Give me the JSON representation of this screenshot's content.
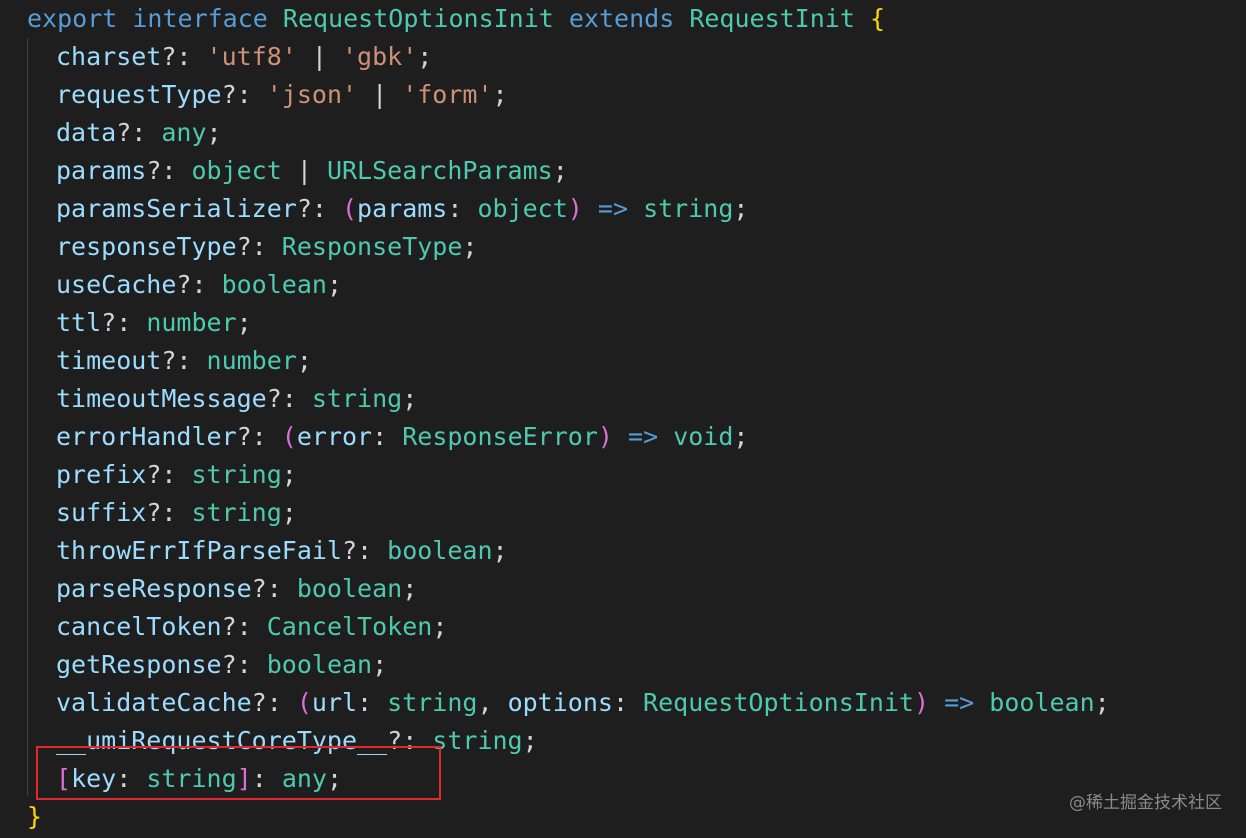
{
  "editor": {
    "lines": [
      {
        "indent": false,
        "tokens": [
          {
            "t": "export",
            "c": "kw"
          },
          {
            "t": " ",
            "c": "punc"
          },
          {
            "t": "interface",
            "c": "kw"
          },
          {
            "t": " ",
            "c": "punc"
          },
          {
            "t": "RequestOptionsInit",
            "c": "type"
          },
          {
            "t": " ",
            "c": "punc"
          },
          {
            "t": "extends",
            "c": "kw"
          },
          {
            "t": " ",
            "c": "punc"
          },
          {
            "t": "RequestInit",
            "c": "type"
          },
          {
            "t": " ",
            "c": "punc"
          },
          {
            "t": "{",
            "c": "brace"
          }
        ]
      },
      {
        "indent": true,
        "tokens": [
          {
            "t": "charset",
            "c": "prop"
          },
          {
            "t": "?: ",
            "c": "punc"
          },
          {
            "t": "'utf8'",
            "c": "str"
          },
          {
            "t": " | ",
            "c": "punc"
          },
          {
            "t": "'gbk'",
            "c": "str"
          },
          {
            "t": ";",
            "c": "punc"
          }
        ]
      },
      {
        "indent": true,
        "tokens": [
          {
            "t": "requestType",
            "c": "prop"
          },
          {
            "t": "?: ",
            "c": "punc"
          },
          {
            "t": "'json'",
            "c": "str"
          },
          {
            "t": " | ",
            "c": "punc"
          },
          {
            "t": "'form'",
            "c": "str"
          },
          {
            "t": ";",
            "c": "punc"
          }
        ]
      },
      {
        "indent": true,
        "tokens": [
          {
            "t": "data",
            "c": "prop"
          },
          {
            "t": "?: ",
            "c": "punc"
          },
          {
            "t": "any",
            "c": "type"
          },
          {
            "t": ";",
            "c": "punc"
          }
        ]
      },
      {
        "indent": true,
        "tokens": [
          {
            "t": "params",
            "c": "prop"
          },
          {
            "t": "?: ",
            "c": "punc"
          },
          {
            "t": "object",
            "c": "type"
          },
          {
            "t": " | ",
            "c": "punc"
          },
          {
            "t": "URLSearchParams",
            "c": "type"
          },
          {
            "t": ";",
            "c": "punc"
          }
        ]
      },
      {
        "indent": true,
        "tokens": [
          {
            "t": "paramsSerializer",
            "c": "prop"
          },
          {
            "t": "?: ",
            "c": "punc"
          },
          {
            "t": "(",
            "c": "paren"
          },
          {
            "t": "params",
            "c": "prop"
          },
          {
            "t": ": ",
            "c": "punc"
          },
          {
            "t": "object",
            "c": "type"
          },
          {
            "t": ")",
            "c": "paren"
          },
          {
            "t": " ",
            "c": "punc"
          },
          {
            "t": "=>",
            "c": "arrow"
          },
          {
            "t": " ",
            "c": "punc"
          },
          {
            "t": "string",
            "c": "type"
          },
          {
            "t": ";",
            "c": "punc"
          }
        ]
      },
      {
        "indent": true,
        "tokens": [
          {
            "t": "responseType",
            "c": "prop"
          },
          {
            "t": "?: ",
            "c": "punc"
          },
          {
            "t": "ResponseType",
            "c": "type"
          },
          {
            "t": ";",
            "c": "punc"
          }
        ]
      },
      {
        "indent": true,
        "tokens": [
          {
            "t": "useCache",
            "c": "prop"
          },
          {
            "t": "?: ",
            "c": "punc"
          },
          {
            "t": "boolean",
            "c": "type"
          },
          {
            "t": ";",
            "c": "punc"
          }
        ]
      },
      {
        "indent": true,
        "tokens": [
          {
            "t": "ttl",
            "c": "prop"
          },
          {
            "t": "?: ",
            "c": "punc"
          },
          {
            "t": "number",
            "c": "type"
          },
          {
            "t": ";",
            "c": "punc"
          }
        ]
      },
      {
        "indent": true,
        "tokens": [
          {
            "t": "timeout",
            "c": "prop"
          },
          {
            "t": "?: ",
            "c": "punc"
          },
          {
            "t": "number",
            "c": "type"
          },
          {
            "t": ";",
            "c": "punc"
          }
        ]
      },
      {
        "indent": true,
        "tokens": [
          {
            "t": "timeoutMessage",
            "c": "prop"
          },
          {
            "t": "?: ",
            "c": "punc"
          },
          {
            "t": "string",
            "c": "type"
          },
          {
            "t": ";",
            "c": "punc"
          }
        ]
      },
      {
        "indent": true,
        "tokens": [
          {
            "t": "errorHandler",
            "c": "prop"
          },
          {
            "t": "?: ",
            "c": "punc"
          },
          {
            "t": "(",
            "c": "paren"
          },
          {
            "t": "error",
            "c": "prop"
          },
          {
            "t": ": ",
            "c": "punc"
          },
          {
            "t": "ResponseError",
            "c": "type"
          },
          {
            "t": ")",
            "c": "paren"
          },
          {
            "t": " ",
            "c": "punc"
          },
          {
            "t": "=>",
            "c": "arrow"
          },
          {
            "t": " ",
            "c": "punc"
          },
          {
            "t": "void",
            "c": "type"
          },
          {
            "t": ";",
            "c": "punc"
          }
        ]
      },
      {
        "indent": true,
        "tokens": [
          {
            "t": "prefix",
            "c": "prop"
          },
          {
            "t": "?: ",
            "c": "punc"
          },
          {
            "t": "string",
            "c": "type"
          },
          {
            "t": ";",
            "c": "punc"
          }
        ]
      },
      {
        "indent": true,
        "tokens": [
          {
            "t": "suffix",
            "c": "prop"
          },
          {
            "t": "?: ",
            "c": "punc"
          },
          {
            "t": "string",
            "c": "type"
          },
          {
            "t": ";",
            "c": "punc"
          }
        ]
      },
      {
        "indent": true,
        "tokens": [
          {
            "t": "throwErrIfParseFail",
            "c": "prop"
          },
          {
            "t": "?: ",
            "c": "punc"
          },
          {
            "t": "boolean",
            "c": "type"
          },
          {
            "t": ";",
            "c": "punc"
          }
        ]
      },
      {
        "indent": true,
        "tokens": [
          {
            "t": "parseResponse",
            "c": "prop"
          },
          {
            "t": "?: ",
            "c": "punc"
          },
          {
            "t": "boolean",
            "c": "type"
          },
          {
            "t": ";",
            "c": "punc"
          }
        ]
      },
      {
        "indent": true,
        "tokens": [
          {
            "t": "cancelToken",
            "c": "prop"
          },
          {
            "t": "?: ",
            "c": "punc"
          },
          {
            "t": "CancelToken",
            "c": "type"
          },
          {
            "t": ";",
            "c": "punc"
          }
        ]
      },
      {
        "indent": true,
        "tokens": [
          {
            "t": "getResponse",
            "c": "prop"
          },
          {
            "t": "?: ",
            "c": "punc"
          },
          {
            "t": "boolean",
            "c": "type"
          },
          {
            "t": ";",
            "c": "punc"
          }
        ]
      },
      {
        "indent": true,
        "tokens": [
          {
            "t": "validateCache",
            "c": "prop"
          },
          {
            "t": "?: ",
            "c": "punc"
          },
          {
            "t": "(",
            "c": "paren"
          },
          {
            "t": "url",
            "c": "prop"
          },
          {
            "t": ": ",
            "c": "punc"
          },
          {
            "t": "string",
            "c": "type"
          },
          {
            "t": ", ",
            "c": "punc"
          },
          {
            "t": "options",
            "c": "prop"
          },
          {
            "t": ": ",
            "c": "punc"
          },
          {
            "t": "RequestOptionsInit",
            "c": "type"
          },
          {
            "t": ")",
            "c": "paren"
          },
          {
            "t": " ",
            "c": "punc"
          },
          {
            "t": "=>",
            "c": "arrow"
          },
          {
            "t": " ",
            "c": "punc"
          },
          {
            "t": "boolean",
            "c": "type"
          },
          {
            "t": ";",
            "c": "punc"
          }
        ]
      },
      {
        "indent": true,
        "tokens": [
          {
            "t": "__umiRequestCoreType__",
            "c": "prop"
          },
          {
            "t": "?: ",
            "c": "punc"
          },
          {
            "t": "string",
            "c": "type"
          },
          {
            "t": ";",
            "c": "punc"
          }
        ]
      },
      {
        "indent": true,
        "tokens": [
          {
            "t": "[",
            "c": "bracket"
          },
          {
            "t": "key",
            "c": "prop"
          },
          {
            "t": ": ",
            "c": "punc"
          },
          {
            "t": "string",
            "c": "type"
          },
          {
            "t": "]",
            "c": "bracket"
          },
          {
            "t": ": ",
            "c": "punc"
          },
          {
            "t": "any",
            "c": "type"
          },
          {
            "t": ";",
            "c": "punc"
          }
        ]
      },
      {
        "indent": false,
        "tokens": [
          {
            "t": "}",
            "c": "brace"
          }
        ]
      }
    ],
    "highlighted_line": 20
  },
  "colors": {
    "background": "#1e1e1e",
    "keyword": "#569cd6",
    "type": "#4ec9b0",
    "property": "#9cdcfe",
    "string": "#ce9178",
    "brace": "#ffd700",
    "paren": "#da70d6",
    "highlight_box": "#e0282e"
  },
  "watermark": {
    "text": "@稀土掘金技术社区"
  }
}
